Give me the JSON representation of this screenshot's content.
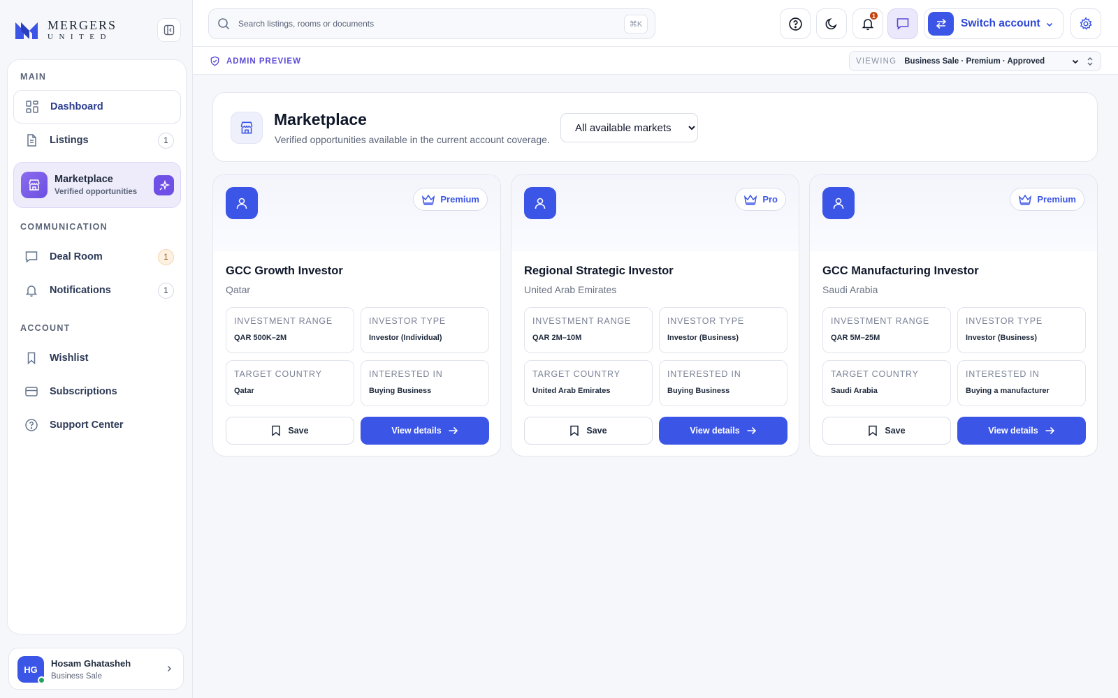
{
  "brand": {
    "word1": "MERGERS",
    "word2": "UNITED"
  },
  "sidebar": {
    "sections": {
      "main": "MAIN",
      "communication": "COMMUNICATION",
      "account": "ACCOUNT"
    },
    "items": {
      "dashboard": {
        "label": "Dashboard"
      },
      "listings": {
        "label": "Listings",
        "count": "1"
      },
      "marketplace": {
        "label": "Marketplace",
        "sublabel": "Verified opportunities"
      },
      "deal_room": {
        "label": "Deal Room",
        "count": "1"
      },
      "notifications": {
        "label": "Notifications",
        "count": "1"
      },
      "wishlist": {
        "label": "Wishlist"
      },
      "subscriptions": {
        "label": "Subscriptions"
      },
      "support": {
        "label": "Support Center"
      }
    },
    "user": {
      "initials": "HG",
      "name": "Hosam Ghatasheh",
      "role": "Business Sale"
    }
  },
  "topbar": {
    "search_placeholder": "Search listings, rooms or documents",
    "shortcut": "⌘K",
    "notification_count": "1",
    "switch_account_label": "Switch account"
  },
  "admin": {
    "label": "ADMIN PREVIEW",
    "viewing_key": "VIEWING",
    "viewing_value": "Business Sale · Premium · Approved"
  },
  "page": {
    "title": "Marketplace",
    "subtitle": "Verified opportunities available in the current account coverage.",
    "market_filter": "All available markets"
  },
  "field_labels": {
    "investment_range": "INVESTMENT RANGE",
    "investor_type": "INVESTOR TYPE",
    "target_country": "TARGET COUNTRY",
    "interested_in": "INTERESTED IN"
  },
  "actions": {
    "save": "Save",
    "view_details": "View details"
  },
  "listings": [
    {
      "tier": "Premium",
      "title": "GCC Growth Investor",
      "country": "Qatar",
      "investment_range": "QAR 500K–2M",
      "investor_type": "Investor (Individual)",
      "target_country": "Qatar",
      "interested_in": "Buying Business"
    },
    {
      "tier": "Pro",
      "title": "Regional Strategic Investor",
      "country": "United Arab Emirates",
      "investment_range": "QAR 2M–10M",
      "investor_type": "Investor (Business)",
      "target_country": "United Arab Emirates",
      "interested_in": "Buying Business"
    },
    {
      "tier": "Premium",
      "title": "GCC Manufacturing Investor",
      "country": "Saudi Arabia",
      "investment_range": "QAR 5M–25M",
      "investor_type": "Investor (Business)",
      "target_country": "Saudi Arabia",
      "interested_in": "Buying a manufacturer"
    }
  ],
  "colors": {
    "primary": "#3b55e6",
    "accent_purple": "#6f4fe6",
    "notification": "#c2410c"
  }
}
